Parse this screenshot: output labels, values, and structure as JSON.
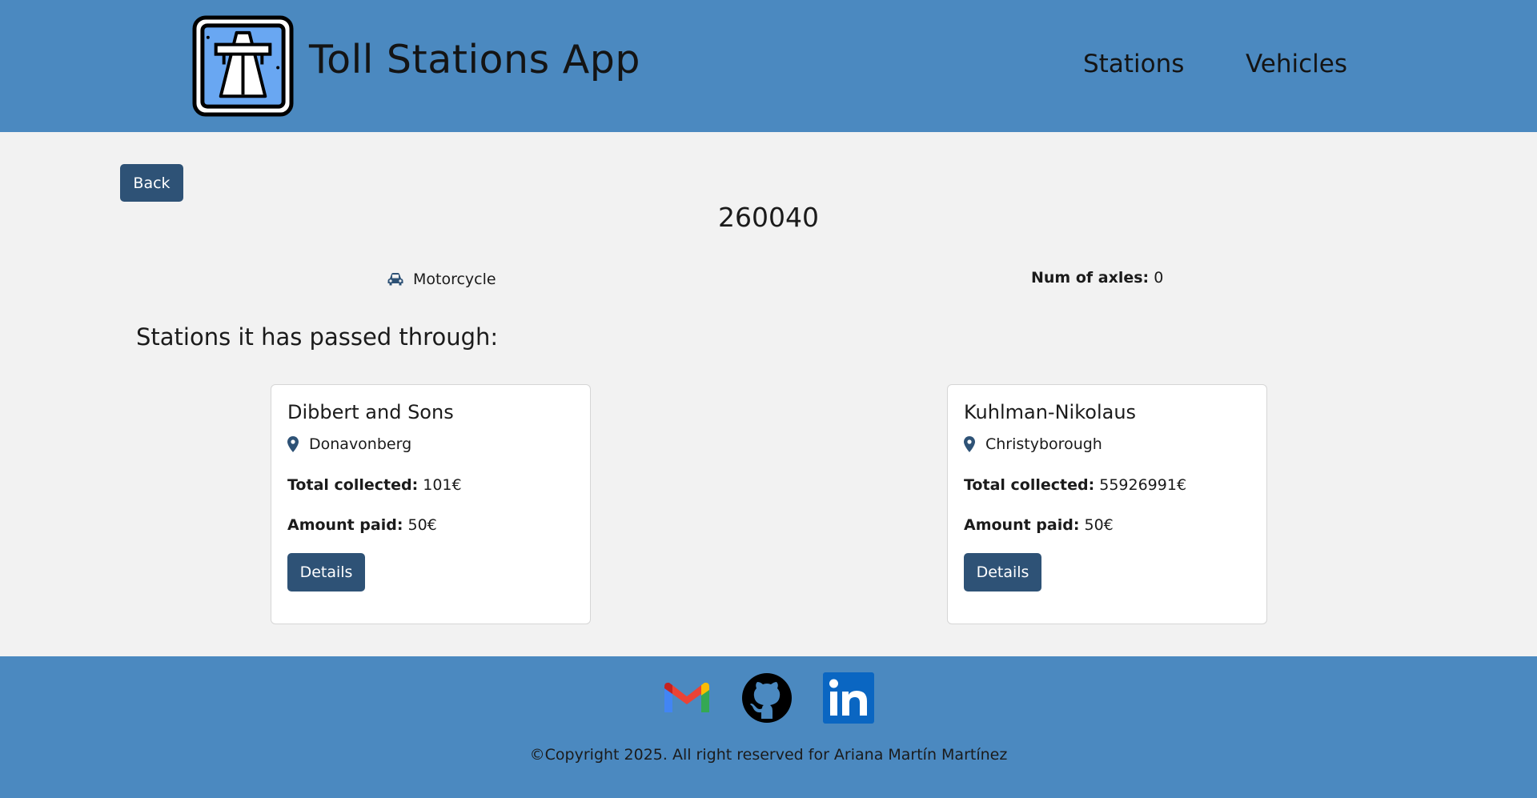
{
  "header": {
    "app_title": "Toll Stations App",
    "logo_icon": "highway-road-icon",
    "nav": [
      {
        "label": "Stations"
      },
      {
        "label": "Vehicles"
      }
    ]
  },
  "main": {
    "back_label": "Back",
    "vehicle_id": "260040",
    "vehicle_type_icon": "car-icon",
    "vehicle_type": "Motorcycle",
    "axles_label": "Num of axles:",
    "axles_value": "0",
    "section_title": "Stations it has passed through:",
    "stations": [
      {
        "name": "Dibbert and Sons",
        "city": "Donavonberg",
        "total_label": "Total collected:",
        "total_value": "101€",
        "paid_label": "Amount paid:",
        "paid_value": "50€",
        "details_label": "Details"
      },
      {
        "name": "Kuhlman-Nikolaus",
        "city": "Christyborough",
        "total_label": "Total collected:",
        "total_value": "55926991€",
        "paid_label": "Amount paid:",
        "paid_value": "50€",
        "details_label": "Details"
      }
    ]
  },
  "footer": {
    "social": [
      "gmail-icon",
      "github-icon",
      "linkedin-icon"
    ],
    "copyright": "©Copyright 2025. All right reserved for Ariana Martín Martínez"
  },
  "colors": {
    "header_bg": "#4b89c0",
    "button_bg": "#2e5276",
    "page_bg": "#f2f2f2"
  }
}
